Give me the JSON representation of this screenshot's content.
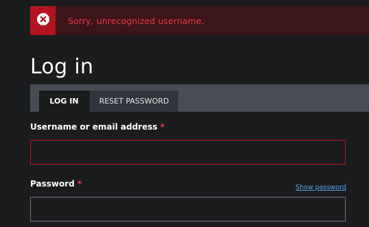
{
  "alert": {
    "type": "error",
    "icon": "error-x-icon",
    "message": "Sorry, unrecognized username."
  },
  "page": {
    "title": "Log in"
  },
  "tabs": [
    {
      "label": "LOG IN",
      "active": true
    },
    {
      "label": "RESET PASSWORD",
      "active": false
    }
  ],
  "form": {
    "username": {
      "label": "Username or email address",
      "required_mark": "*",
      "value": ""
    },
    "password": {
      "label": "Password",
      "required_mark": "*",
      "value": "",
      "show_link": "Show password"
    }
  },
  "colors": {
    "background": "#1b1c1e",
    "error_accent": "#b3141f",
    "error_text": "#e63946",
    "link": "#58a6e8",
    "tab_bar": "#484d55"
  }
}
